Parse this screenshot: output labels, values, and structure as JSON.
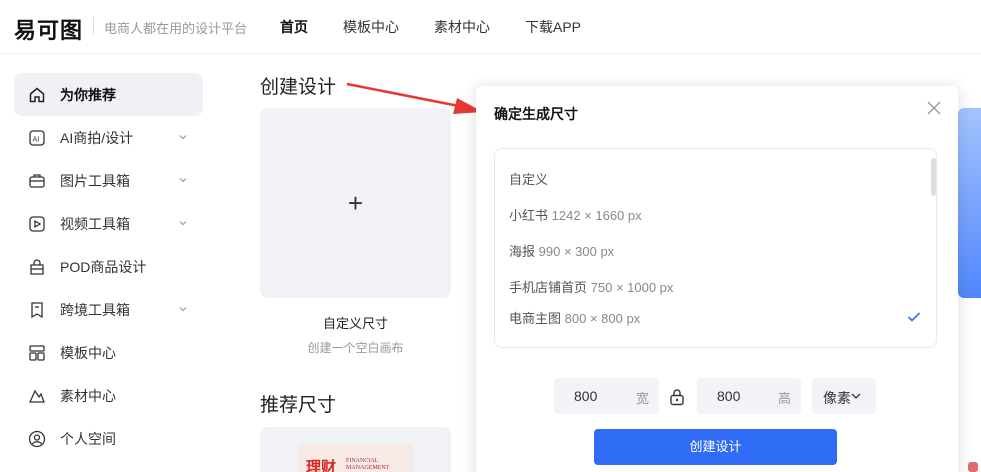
{
  "header": {
    "logo": "易可图",
    "slogan": "电商人都在用的设计平台",
    "nav": [
      "首页",
      "模板中心",
      "素材中心",
      "下载APP"
    ]
  },
  "sidebar": {
    "items": [
      {
        "label": "为你推荐",
        "icon": "home-icon",
        "active": true,
        "expandable": false
      },
      {
        "label": "AI商拍/设计",
        "icon": "ai-icon",
        "expandable": true
      },
      {
        "label": "图片工具箱",
        "icon": "image-toolbox-icon",
        "expandable": true
      },
      {
        "label": "视频工具箱",
        "icon": "video-toolbox-icon",
        "expandable": true
      },
      {
        "label": "POD商品设计",
        "icon": "bag-icon",
        "expandable": false
      },
      {
        "label": "跨境工具箱",
        "icon": "crossborder-icon",
        "expandable": true
      },
      {
        "label": "模板中心",
        "icon": "template-icon",
        "expandable": false
      },
      {
        "label": "素材中心",
        "icon": "material-icon",
        "expandable": false
      },
      {
        "label": "个人空间",
        "icon": "user-icon",
        "expandable": false
      }
    ]
  },
  "main": {
    "create_title": "创建设计",
    "custom_card_label": "自定义尺寸",
    "custom_card_sub": "创建一个空白画布",
    "recommend_title": "推荐尺寸",
    "thumb_big": "理财",
    "thumb_small": "FINANCIAL MANAGEMENT"
  },
  "modal": {
    "title": "确定生成尺寸",
    "options": [
      {
        "name": "自定义",
        "size": ""
      },
      {
        "name": "小红书",
        "size": "1242 × 1660 px"
      },
      {
        "name": "海报",
        "size": "990 × 300 px"
      },
      {
        "name": "手机店铺首页",
        "size": "750 × 1000 px"
      },
      {
        "name": "电商主图",
        "size": "800 × 800 px",
        "selected": true
      }
    ],
    "width_value": "800",
    "width_unit": "宽",
    "height_value": "800",
    "height_unit": "高",
    "unit_select": "像素",
    "create_button": "创建设计"
  },
  "colors": {
    "accent": "#2f6df6",
    "arrow": "#e53935"
  }
}
